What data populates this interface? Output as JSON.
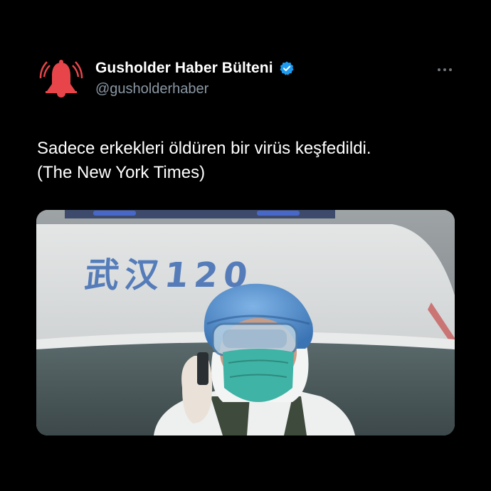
{
  "author": {
    "display_name": "Gusholder Haber Bülteni",
    "handle": "@gusholderhaber",
    "verified": true,
    "avatar_icon": "bell-icon",
    "avatar_color": "#e8454a"
  },
  "tweet": {
    "text_line1": "Sadece erkekleri öldüren bir virüs keşfedildi.",
    "text_line2": "(The New York Times)"
  },
  "media": {
    "vehicle_text": "武汉120"
  },
  "colors": {
    "background": "#000000",
    "verified_badge": "#1d9bf0",
    "handle": "#8b98a5"
  },
  "icons": {
    "more": "more-horizontal-icon",
    "verified": "verified-badge-icon"
  }
}
